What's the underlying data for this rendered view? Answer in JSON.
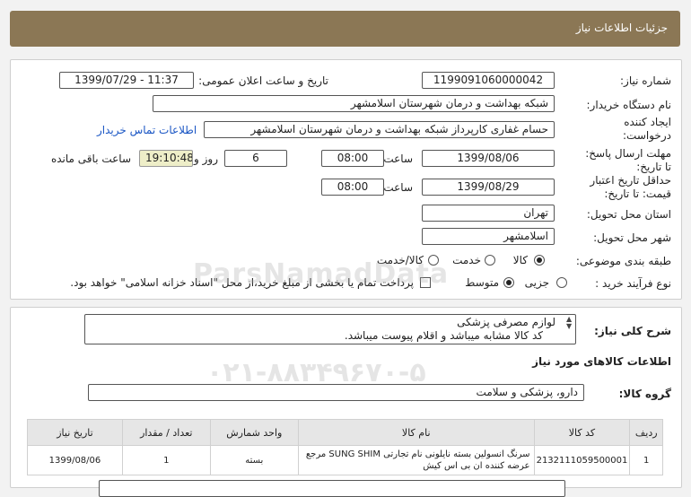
{
  "header": {
    "title": "جزئیات اطلاعات نیاز"
  },
  "form": {
    "need_number_label": "شماره نیاز:",
    "need_number": "1199091060000042",
    "announce_label": "تاریخ و ساعت اعلان عمومی:",
    "announce_value": "1399/07/29 - 11:37",
    "buyer_label": "نام دستگاه خریدار:",
    "buyer_value": "شبکه بهداشت و درمان شهرستان اسلامشهر",
    "creator_label_1": "ایجاد کننده",
    "creator_label_2": "درخواست:",
    "creator_value": "حسام غفاری کارپرداز شبکه بهداشت و درمان شهرستان اسلامشهر",
    "contact_link": "اطلاعات تماس خریدار",
    "deadline_label_1": "مهلت ارسال پاسخ:",
    "deadline_label_2": "تا تاریخ:",
    "deadline_date": "1399/08/06",
    "time_label": "ساعت",
    "deadline_time": "08:00",
    "days_value": "6",
    "days_label": "روز و",
    "remaining_time": "19:10:48",
    "remaining_label": "ساعت باقی مانده",
    "validity_label_1": "حداقل تاریخ اعتبار",
    "validity_label_2": "قیمت: تا تاریخ:",
    "validity_date": "1399/08/29",
    "validity_time": "08:00",
    "province_label": "استان محل تحویل:",
    "province_value": "تهران",
    "city_label": "شهر محل تحویل:",
    "city_value": "اسلامشهر",
    "category_label": "طبقه بندی موضوعی:",
    "category_options": [
      "کالا",
      "خدمت",
      "کالا/خدمت"
    ],
    "category_selected": "کالا",
    "process_label": "نوع فرآیند خرید :",
    "process_options": [
      "جزیی",
      "متوسط"
    ],
    "process_selected": "متوسط",
    "payment_note": "پرداخت تمام یا بخشی از مبلغ خرید،از محل \"اسناد خزانه اسلامی\" خواهد بود."
  },
  "description": {
    "label": "شرح کلی نیاز:",
    "line1": "لوازم مصرفی پزشکی",
    "line2": "کد کالا مشابه میباشد و اقلام پیوست میباشد."
  },
  "goods": {
    "section_title": "اطلاعات کالاهای مورد نیاز",
    "group_label": "گروه کالا:",
    "group_value": "دارو، پزشکی و سلامت",
    "columns": [
      "ردیف",
      "کد کالا",
      "نام کالا",
      "واحد شمارش",
      "تعداد / مقدار",
      "تاریخ نیاز"
    ],
    "rows": [
      {
        "index": "1",
        "code": "2132111059500001",
        "name": "سرنگ انسولین بسته نایلونی نام تجارتی SUNG SHIM مرجع عرضه کننده ان بی اس کیش",
        "unit": "بسته",
        "qty": "1",
        "date": "1399/08/06"
      }
    ]
  },
  "watermark": {
    "line1": "ParsNamadData",
    "line2": "۰۲۱-۸۸۳۴۹۶۷۰-۵"
  },
  "colors": {
    "header_bg": "#8b7755",
    "link": "#1a56c4"
  }
}
